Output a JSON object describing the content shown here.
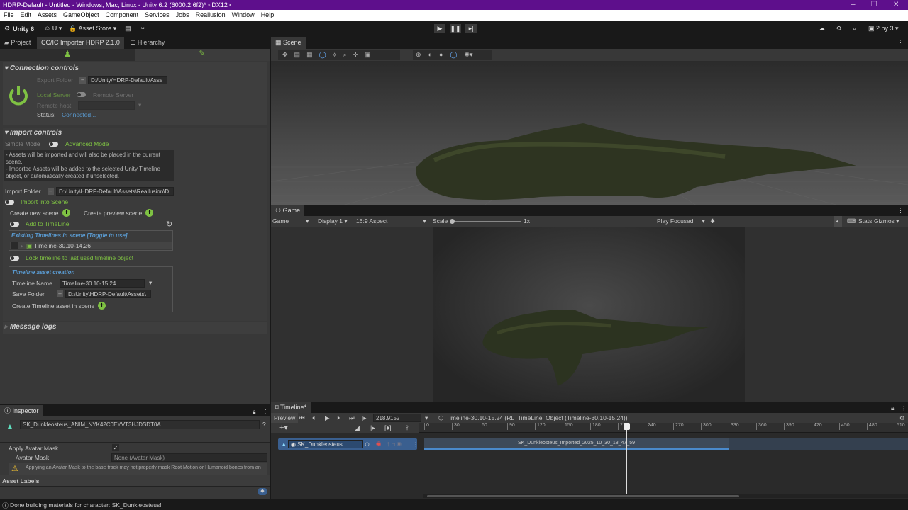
{
  "window": {
    "title": "HDRP-Default - Untitled - Windows, Mac, Linux - Unity 6.2 (6000.2.6f2)* <DX12>",
    "minimize": "–",
    "maximize": "❐",
    "close": "✕"
  },
  "menu": [
    "File",
    "Edit",
    "Assets",
    "GameObject",
    "Component",
    "Services",
    "Jobs",
    "Reallusion",
    "Window",
    "Help"
  ],
  "toolbar": {
    "unity": "Unity 6",
    "account": "U",
    "asset_store": "Asset Store",
    "layout": "2 by 3"
  },
  "left_tabs": [
    "Project",
    "CC/IC Importer HDRP 2.1.0",
    "Hierarchy"
  ],
  "importer": {
    "connection": {
      "title": "Connection controls",
      "export_folder_label": "Export Folder",
      "export_folder": "D:/Unity/HDRP-Default/Asse",
      "local_server": "Local Server",
      "remote_server": "Remote Server",
      "remote_host_label": "Remote host",
      "status_label": "Status:",
      "status": "Connected..."
    },
    "import": {
      "title": "Import controls",
      "simple_mode": "Simple Mode",
      "advanced_mode": "Advanced Mode",
      "info": "- Assets will be imported and will also be placed in the current scene.\n- Imported Assets will be added to the selected Unity Timeline object, or automatically created if unselected.",
      "import_folder_label": "Import Folder",
      "import_folder": "D:\\Unity\\HDRP-Default\\Assets\\Reallusion\\D",
      "import_into_scene": "Import Into Scene",
      "create_new_scene": "Create new scene",
      "create_preview_scene": "Create preview scene",
      "add_to_timeline": "Add to TimeLine",
      "existing_header": "Existing Timelines in scene [Toggle to use]",
      "existing_item": "Timeline-30.10-14.26",
      "lock_timeline": "Lock timeline to last used timeline object",
      "asset_creation_header": "Timeline asset creation",
      "timeline_name_label": "Timeline Name",
      "timeline_name": "Timeline-30.10-15.24",
      "save_folder_label": "Save Folder",
      "save_folder": "D:\\Unity\\HDRP-Default\\Assets\\",
      "create_asset": "Create Timeline asset in scene"
    },
    "message_logs": "Message logs"
  },
  "inspector": {
    "tab": "Inspector",
    "object_name": "SK_Dunkleosteus_ANIM_NYK42C0EYVT3HJDSDT0A",
    "apply_mask": "Apply Avatar Mask",
    "avatar_mask_label": "Avatar Mask",
    "avatar_mask": "None (Avatar Mask)",
    "warning": "Applying an Avatar Mask to the base track may not properly mask Root Motion or Humanoid bones from an",
    "asset_labels": "Asset Labels"
  },
  "status_bar": "Done building materials for character: SK_Dunkleosteus!",
  "scene": {
    "tab": "Scene"
  },
  "game": {
    "tab": "Game",
    "mode": "Game",
    "display": "Display 1",
    "aspect": "16:9 Aspect",
    "scale_label": "Scale",
    "scale": "1x",
    "play_focused": "Play Focused",
    "stats": "Stats",
    "gizmos": "Gizmos"
  },
  "timeline": {
    "tab": "Timeline*",
    "preview": "Preview",
    "frame": "218.9152",
    "asset": "Timeline-30.10-15.24 (RL_TimeLine_Object (Timeline-30.10-15.24))",
    "track": "SK_Dunkleosteus",
    "clip": "SK_Dunkleosteus_Imported_2025_10_30_18_47_59",
    "playhead_frame": 218.9152,
    "clip_end_frame": 330,
    "ticks": [
      "0",
      "30",
      "60",
      "90",
      "120",
      "150",
      "180",
      "210",
      "240",
      "270",
      "300",
      "330",
      "360",
      "390",
      "420",
      "450",
      "480",
      "510"
    ]
  },
  "colors": {
    "title": "#5e0f8c",
    "accent_green": "#7fc243",
    "link_blue": "#5a9ad0",
    "track_blue": "#3a5f8f"
  }
}
